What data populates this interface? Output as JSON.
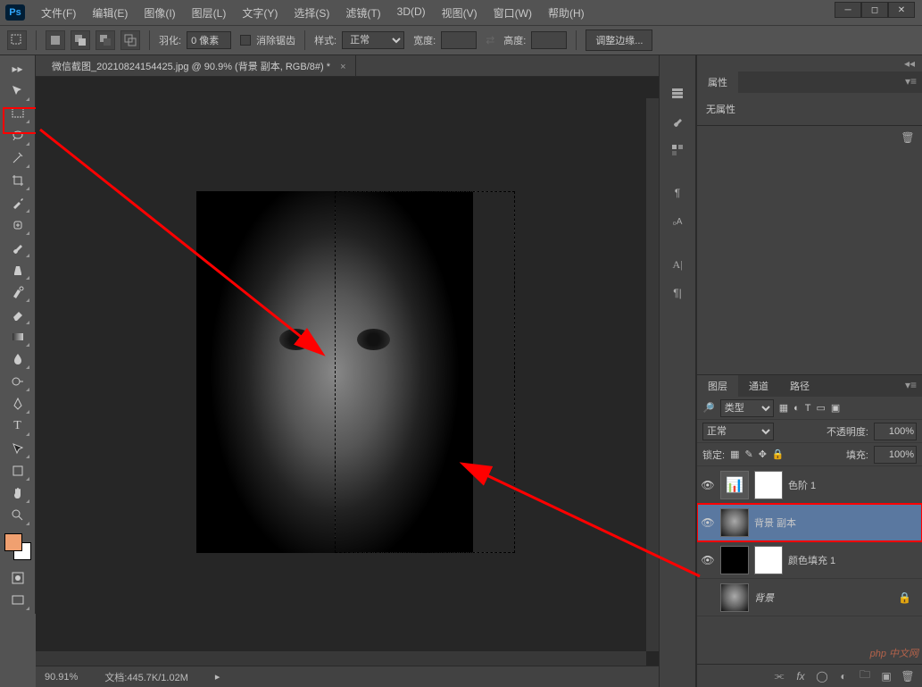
{
  "app": {
    "logo_text": "Ps"
  },
  "menu": {
    "file": "文件(F)",
    "edit": "编辑(E)",
    "image": "图像(I)",
    "layer": "图层(L)",
    "type": "文字(Y)",
    "select": "选择(S)",
    "filter": "滤镜(T)",
    "3d": "3D(D)",
    "view": "视图(V)",
    "window": "窗口(W)",
    "help": "帮助(H)"
  },
  "options": {
    "feather_label": "羽化:",
    "feather_value": "0 像素",
    "antialias_label": "消除锯齿",
    "style_label": "样式:",
    "style_value": "正常",
    "width_label": "宽度:",
    "width_value": "",
    "height_label": "高度:",
    "height_value": "",
    "refine_edge": "调整边缘..."
  },
  "document": {
    "tab_title": "微信截图_20210824154425.jpg @ 90.9% (背景 副本, RGB/8#) *"
  },
  "status": {
    "zoom": "90.91%",
    "docinfo": "文档:445.7K/1.02M"
  },
  "panels": {
    "properties_tab": "属性",
    "no_properties": "无属性",
    "layers_tab": "图层",
    "channels_tab": "通道",
    "paths_tab": "路径",
    "kind_label": "类型",
    "blend_mode": "正常",
    "opacity_label": "不透明度:",
    "opacity_value": "100%",
    "lock_label": "锁定:",
    "fill_label": "填充:",
    "fill_value": "100%"
  },
  "layers": [
    {
      "name": "色阶 1",
      "visible": true,
      "type": "levels",
      "selected": false
    },
    {
      "name": "背景 副本",
      "visible": true,
      "type": "image",
      "selected": true,
      "highlighted": true
    },
    {
      "name": "颜色填充 1",
      "visible": true,
      "type": "fill",
      "selected": false
    },
    {
      "name": "背景",
      "visible": false,
      "type": "bg",
      "selected": false,
      "locked": true,
      "italic": true
    }
  ],
  "watermark": "php 中文网"
}
